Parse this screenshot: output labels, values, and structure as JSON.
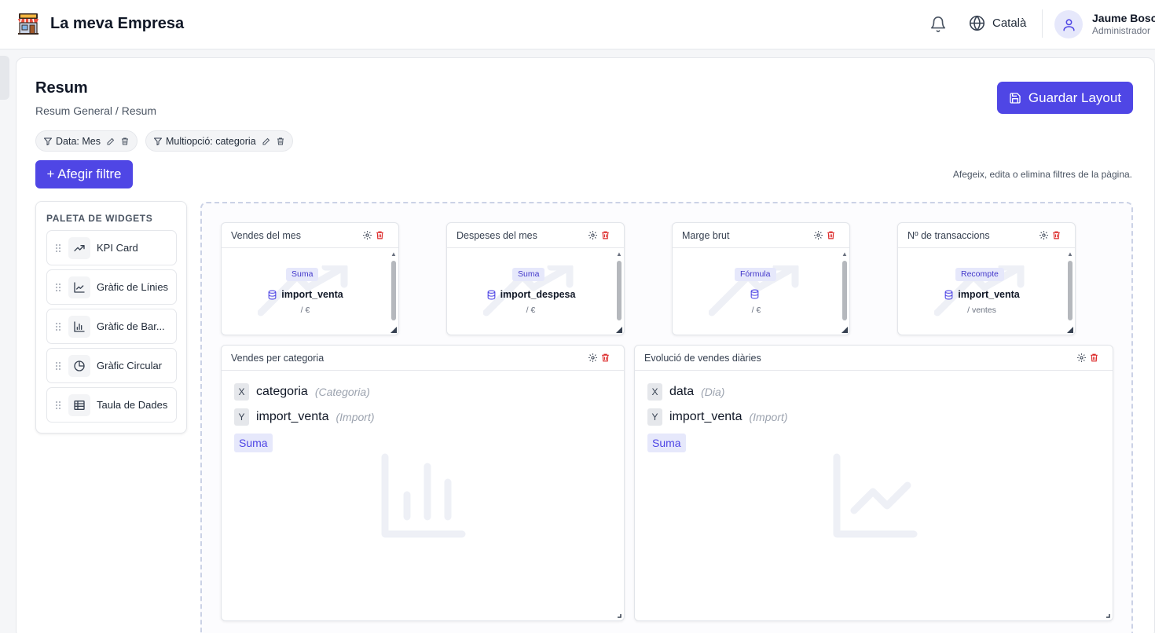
{
  "app": {
    "name": "La meva Empresa",
    "language": "Català",
    "user": {
      "name": "Jaume Bosch",
      "role": "Administrador"
    }
  },
  "page": {
    "title": "Resum",
    "breadcrumb": "Resum General / Resum",
    "save_label": "Guardar Layout",
    "add_filter_label": "+ Afegir filtre",
    "hint": "Afegeix, edita o elimina filtres de la pàgina.",
    "filters": [
      {
        "label": "Data: Mes"
      },
      {
        "label": "Multiopció: categoria"
      }
    ]
  },
  "palette": {
    "title": "PALETA DE WIDGETS",
    "items": [
      {
        "label": "KPI Card",
        "icon": "trending-up-icon"
      },
      {
        "label": "Gràfic de Línies",
        "icon": "line-chart-icon"
      },
      {
        "label": "Gràfic de Bar...",
        "icon": "bar-chart-icon"
      },
      {
        "label": "Gràfic Circular",
        "icon": "pie-chart-icon"
      },
      {
        "label": "Taula de Dades",
        "icon": "table-icon"
      }
    ]
  },
  "kpis": [
    {
      "title": "Vendes del mes",
      "badge": "Suma",
      "field": "import_venta",
      "unit": "/ €"
    },
    {
      "title": "Despeses del mes",
      "badge": "Suma",
      "field": "import_despesa",
      "unit": "/ €"
    },
    {
      "title": "Marge brut",
      "badge": "Fórmula",
      "field": "",
      "unit": "/ €"
    },
    {
      "title": "Nº de transaccions",
      "badge": "Recompte",
      "field": "import_venta",
      "unit": "/ ventes"
    }
  ],
  "charts": [
    {
      "title": "Vendes per categoria",
      "x": {
        "key": "X",
        "field": "categoria",
        "type": "(Categoria)"
      },
      "y": {
        "key": "Y",
        "field": "import_venta",
        "type": "(Import)"
      },
      "agg": "Suma",
      "ghost": "bar-chart-icon"
    },
    {
      "title": "Evolució de vendes diàries",
      "x": {
        "key": "X",
        "field": "data",
        "type": "(Dia)"
      },
      "y": {
        "key": "Y",
        "field": "import_venta",
        "type": "(Import)"
      },
      "agg": "Suma",
      "ghost": "line-chart-icon"
    }
  ],
  "colors": {
    "accent": "#4f46e5",
    "danger": "#dc2626",
    "badge_bg": "#e6e8fb"
  }
}
